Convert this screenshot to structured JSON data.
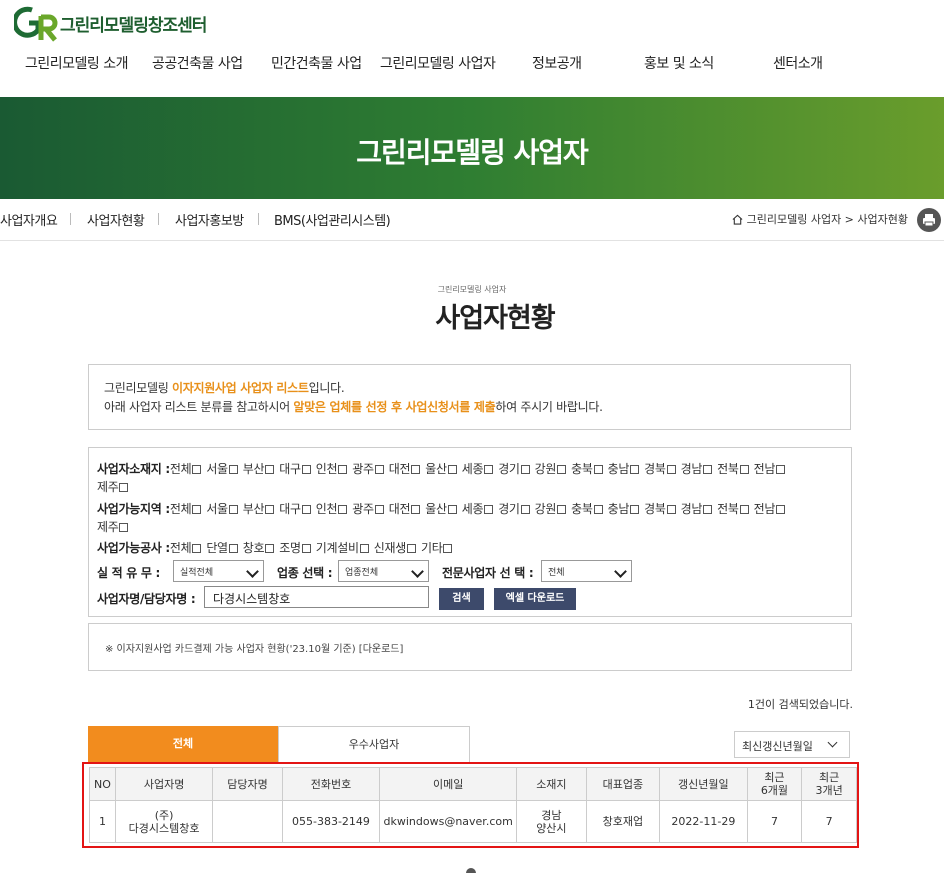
{
  "brand": {
    "name": "그린리모델링창조센터",
    "mark": "GR"
  },
  "gnb": [
    "그린리모델링 소개",
    "공공건축물 사업",
    "민간건축물 사업",
    "그린리모델링 사업자",
    "정보공개",
    "홍보 및 소식",
    "센터소개"
  ],
  "banner": {
    "title": "그린리모델링 사업자"
  },
  "subnav": [
    "사업자개요",
    "사업자현황",
    "사업자홍보방",
    "BMS(사업관리시스템)"
  ],
  "breadcrumb": "그린리모델링 사업자 > 사업자현황",
  "page": {
    "subtitle": "그린리모델링 사업자",
    "title": "사업자현황"
  },
  "notice": {
    "line1_pre": "그린리모델링 ",
    "line1_hl": "이자지원사업 사업자 리스트",
    "line1_post": "입니다.",
    "line2_pre": "아래 사업자 리스트 분류를 참고하시어 ",
    "line2_hl": "알맞은 업체를 선정 후 사업신청서를 제출",
    "line2_post": "하여 주시기 바랍니다."
  },
  "filter": {
    "location_label": "사업자소재지 :",
    "area_label": "사업가능지역 :",
    "regions": [
      "전체",
      "서울",
      "부산",
      "대구",
      "인천",
      "광주",
      "대전",
      "울산",
      "세종",
      "경기",
      "강원",
      "충북",
      "충남",
      "경북",
      "경남",
      "전북",
      "전남"
    ],
    "last_region": "제주",
    "work_label": "사업가능공사 :",
    "works": [
      "전체",
      "단열",
      "창호",
      "조명",
      "기계설비",
      "신재생",
      "기타"
    ],
    "record_label": "실 적 유 무 :",
    "record_value": "실적전체",
    "type_label": "업종 선택 :",
    "type_value": "업종전체",
    "expert_label": "전문사업자 선 택 :",
    "expert_value": "전체",
    "name_label": "사업자명/담당자명 :",
    "name_value": "다경시스템창호",
    "search_button": "검색",
    "excel_button": "엑셀 다운로드"
  },
  "card_note": "※ 이자지원사업 카드결제 가능 사업자 현황('23.10월 기준) [다운로드]",
  "result_count": "1건이 검색되었습니다.",
  "tabs": [
    "전체",
    "우수사업자"
  ],
  "sort": "최신갱신년월일",
  "table": {
    "headers": [
      "NO",
      "사업자명",
      "담당자명",
      "전화번호",
      "이메일",
      "소재지",
      "대표업종",
      "갱신년월일",
      "최근\n6개월",
      "최근\n3개년"
    ],
    "rows": [
      [
        "1",
        "(주)\n다경시스템창호",
        "",
        "055-383-2149",
        "dkwindows@naver.com",
        "경남\n양산시",
        "창호재업",
        "2022-11-29",
        "7",
        "7"
      ]
    ]
  },
  "colors": {
    "green_dark": "#1a5a33",
    "green_light": "#6a9d2c",
    "orange": "#f28c1e",
    "highlight": "#e8901a",
    "button": "#3d4a6b",
    "outline_red": "#e31414"
  }
}
